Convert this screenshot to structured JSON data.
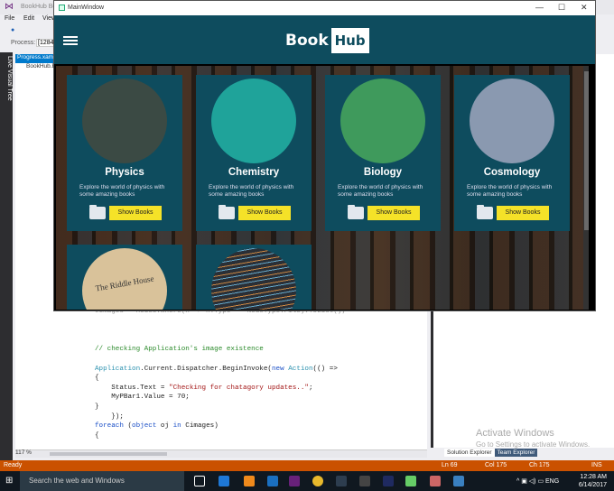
{
  "vs": {
    "title": "BookHub Be",
    "menu": [
      "File",
      "Edit",
      "View"
    ],
    "process_label": "Process:",
    "process_value": "[1284]",
    "live_tree": "Live Visual Tree",
    "doc_tab": "Progress.xaml",
    "doc_sub": "BookHub.B",
    "zoom": "117 %",
    "code": {
      "line0": "Cimages = nodes.Where(n => n.Type == NodeType.File).ToList();",
      "comment": "// checking Application's image existence",
      "l1a": "Application",
      "l1b": ".Current.Dispatcher.BeginInvoke(",
      "l1c": "new",
      "l1d": "Action",
      "l1e": "(() =>",
      "l2": "{",
      "l3a": "    Status.Text = ",
      "l3b": "\"Checking for chatagory updates..\"",
      "l3c": ";",
      "l4": "    MyPBar1.Value = 70;",
      "l5": "}",
      "l6": "    });",
      "l7a": "foreach",
      "l7b": " (",
      "l7c": "object",
      "l7d": " oj ",
      "l7e": "in",
      "l7f": " Cimages)",
      "l8": "{"
    },
    "activate_title": "Activate Windows",
    "activate_sub": "Go to Settings to activate Windows.",
    "tabs": [
      "Solution Explorer",
      "Team Explorer"
    ]
  },
  "status": {
    "ready": "Ready",
    "ln": "Ln 69",
    "col": "Col 175",
    "ch": "Ch 175",
    "mode": "INS"
  },
  "taskbar": {
    "search": "Search the web and Windows",
    "lang": "ENG",
    "time": "12:28 AM",
    "date": "6/14/2017"
  },
  "window": {
    "title": "MainWindow",
    "logo_book": "Book",
    "logo_hub": "Hub",
    "cards": [
      {
        "title": "Physics",
        "desc": "Explore the world of physics with some amazing books",
        "button": "Show Books",
        "color": "#3b4a44"
      },
      {
        "title": "Chemistry",
        "desc": "Explore the world of physics with some amazing books",
        "button": "Show Books",
        "color": "#1fa39a"
      },
      {
        "title": "Biology",
        "desc": "Explore the world of physics with some amazing books",
        "button": "Show Books",
        "color": "#3f9a5c"
      },
      {
        "title": "Cosmology",
        "desc": "Explore the world of physics with some amazing books",
        "button": "Show Books",
        "color": "#8a99b0"
      }
    ],
    "row2": [
      {
        "caption": "The Riddle House",
        "color": "#d9c29a"
      },
      {
        "color": "#2a2f36"
      }
    ]
  }
}
